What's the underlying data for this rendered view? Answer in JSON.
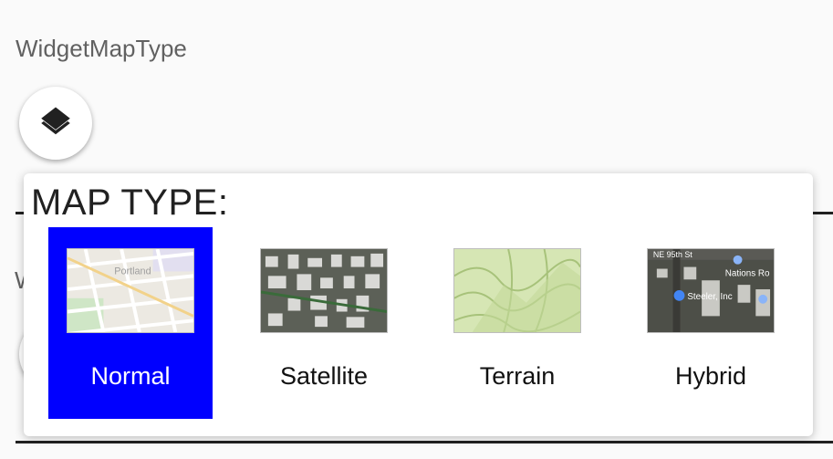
{
  "widget": {
    "title": "WidgetMapType",
    "button_icon": "layers-icon"
  },
  "background": {
    "partial_letter": "W"
  },
  "popup": {
    "title": "MAP TYPE:",
    "options": [
      {
        "label": "Normal",
        "selected": true,
        "thumb_labels": [
          "Portland"
        ]
      },
      {
        "label": "Satellite",
        "selected": false
      },
      {
        "label": "Terrain",
        "selected": false
      },
      {
        "label": "Hybrid",
        "selected": false,
        "thumb_labels": [
          "NE 95th St",
          "Nations Ro",
          "Steeler, Inc"
        ]
      }
    ]
  },
  "colors": {
    "selected_bg": "#0000ff",
    "selected_text": "#ffffff"
  }
}
